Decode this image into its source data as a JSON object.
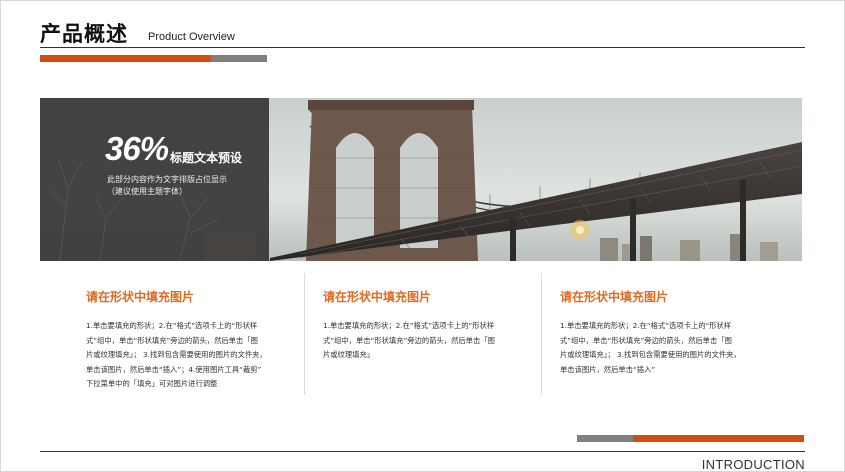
{
  "header": {
    "title": "产品概述",
    "subtitle": "Product Overview"
  },
  "hero": {
    "stat": "36%",
    "heading": "标题文本预设",
    "desc_lines": [
      "此部分内容作为文字排版占位显示",
      "（建议使用主题字体）"
    ]
  },
  "columns": [
    {
      "title": "请在形状中填充图片",
      "lines": [
        "1.单击要填充的形状；2.在“格式”选项卡上的“形状样",
        "式”组中，单击“形状填充”旁边的箭头，然后单击「图",
        "片或纹理填充」； 3.找到包含需要使用的图片的文件夹，",
        "单击该图片，然后单击“插入”；4.使用图片工具“裁剪”",
        "下拉菜单中的「填充」可对图片进行调整"
      ]
    },
    {
      "title": "请在形状中填充图片",
      "lines": [
        "1.单击要填充的形状；2.在“格式”选项卡上的“形状样",
        "式”组中，单击“形状填充”旁边的箭头，然后单击「图",
        "片或纹理填充」"
      ]
    },
    {
      "title": "请在形状中填充图片",
      "lines": [
        "1.单击要填充的形状；2.在“格式”选项卡上的“形状样",
        "式”组中，单击“形状填充”旁边的箭头，然后单击「图",
        "片或纹理填充」； 3.找到包含需要使用的图片的文件夹，",
        "单击该图片，然后单击“插入”"
      ]
    }
  ],
  "footer": {
    "label": "INTRODUCTION"
  },
  "colors": {
    "accent": "#d14e13",
    "heading": "#e06a22",
    "gray": "#808080"
  }
}
